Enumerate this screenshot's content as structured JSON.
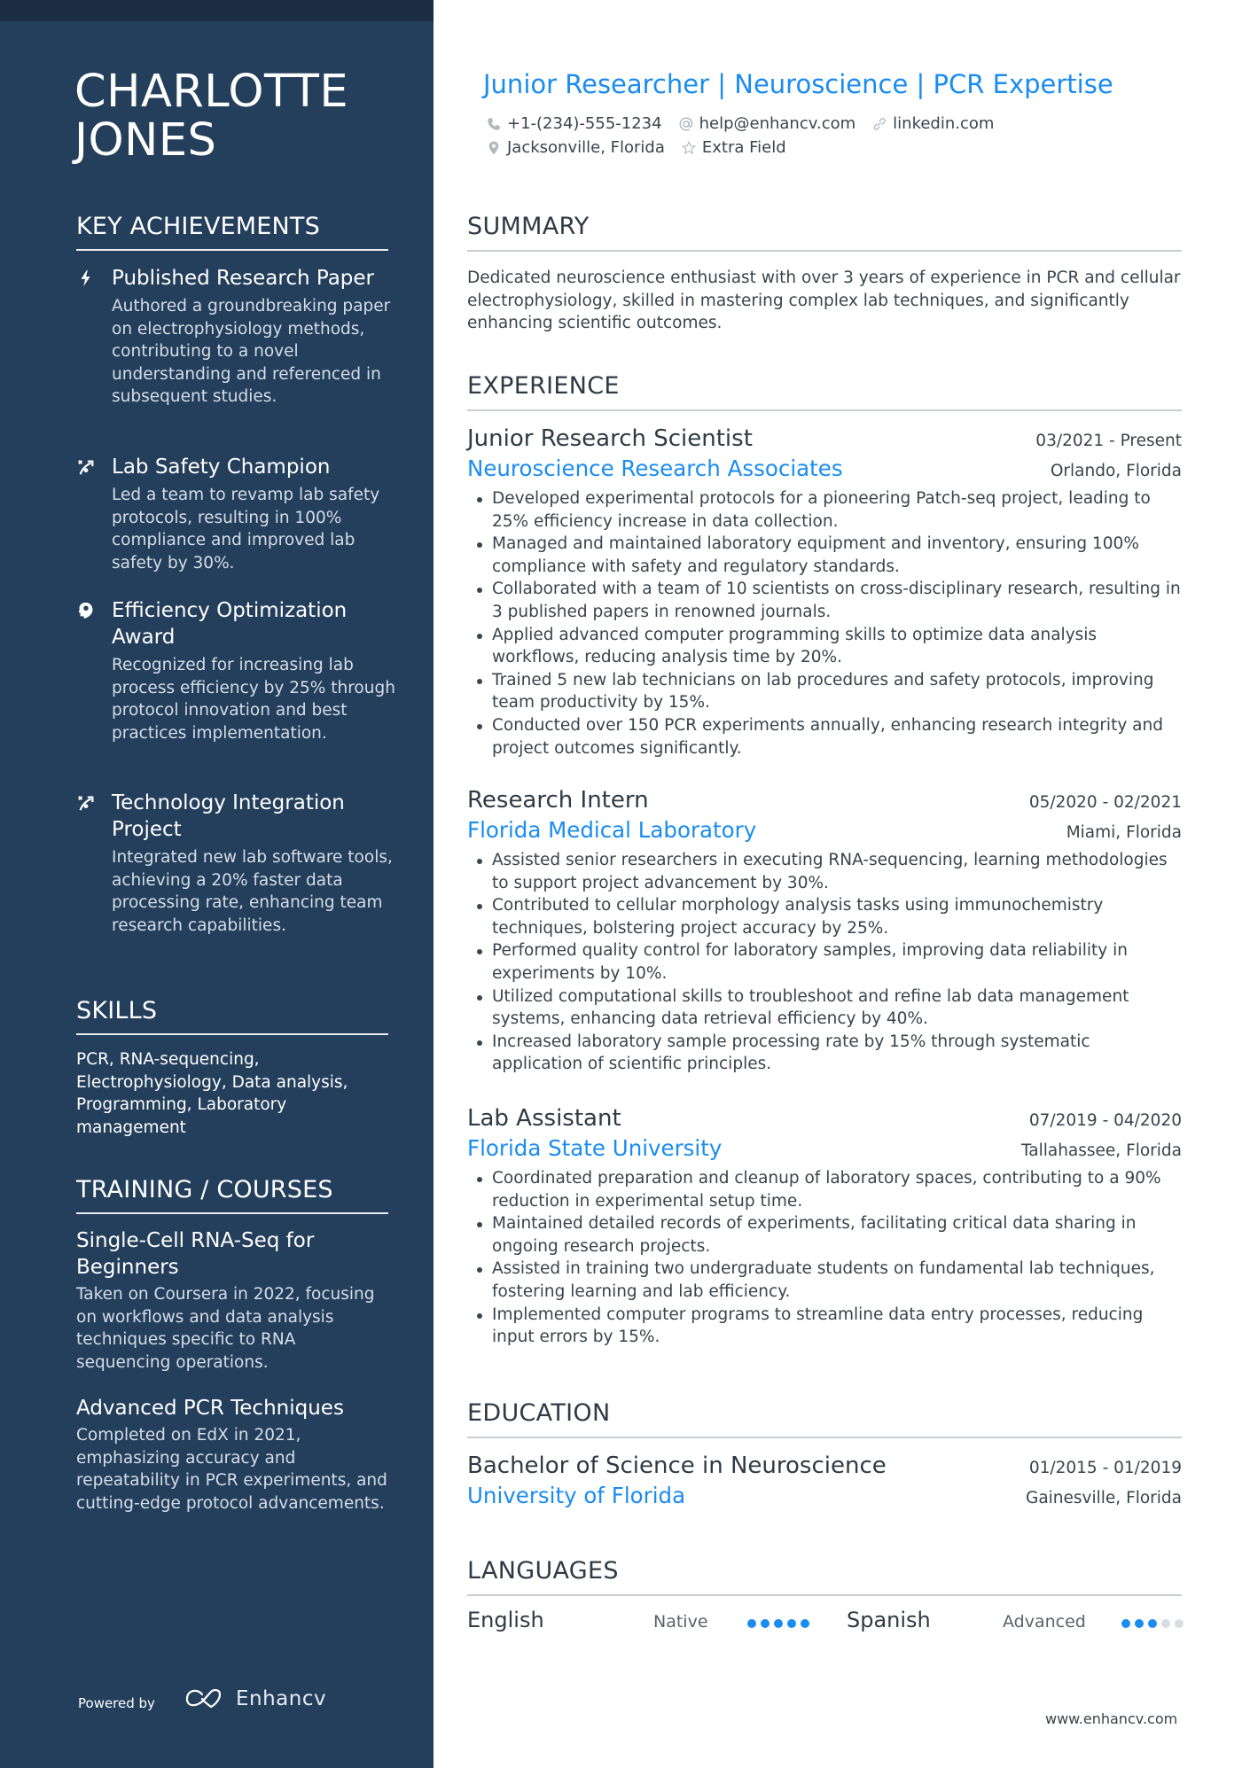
{
  "sidebar": {
    "name_line1": "CHARLOTTE",
    "name_line2": "JONES",
    "achievements_heading": "KEY ACHIEVEMENTS",
    "achievements": [
      {
        "icon": "lightning-icon",
        "title": "Published Research Paper",
        "description": "Authored a groundbreaking paper on electrophysiology methods, contributing to a novel understanding and referenced in subsequent studies."
      },
      {
        "icon": "strategy-icon",
        "title": "Lab Safety Champion",
        "description": "Led a team to revamp lab safety protocols, resulting in 100% compliance and improved lab safety by 30%."
      },
      {
        "icon": "head-brain-icon",
        "title": "Efficiency Optimization Award",
        "description": "Recognized for increasing lab process efficiency by 25% through protocol innovation and best practices implementation."
      },
      {
        "icon": "strategy-icon",
        "title": "Technology Integration Project",
        "description": "Integrated new lab software tools, achieving a 20% faster data processing rate, enhancing team research capabilities."
      }
    ],
    "skills_heading": "SKILLS",
    "skills_text": "PCR, RNA-sequencing, Electrophysiology, Data analysis, Programming, Laboratory management",
    "training_heading": "TRAINING / COURSES",
    "courses": [
      {
        "title": "Single-Cell RNA-Seq for Beginners",
        "description": "Taken on Coursera in 2022, focusing on workflows and data analysis techniques specific to RNA sequencing operations."
      },
      {
        "title": "Advanced PCR Techniques",
        "description": "Completed on EdX in 2021, emphasizing accuracy and repeatability in PCR experiments, and cutting-edge protocol advancements."
      }
    ],
    "powered_by": "Powered by",
    "brand_name": "Enhancv"
  },
  "header": {
    "title": "Junior Researcher | Neuroscience | PCR Expertise",
    "phone": "+1-(234)-555-1234",
    "email": "help@enhancv.com",
    "linkedin": "linkedin.com",
    "location": "Jacksonville, Florida",
    "extra": "Extra Field"
  },
  "summary": {
    "heading": "SUMMARY",
    "text": "Dedicated neuroscience enthusiast with over 3 years of experience in PCR and cellular electrophysiology, skilled in mastering complex lab techniques, and significantly enhancing scientific outcomes."
  },
  "experience": {
    "heading": "EXPERIENCE",
    "jobs": [
      {
        "title": "Junior Research Scientist",
        "dates": "03/2021 - Present",
        "company": "Neuroscience Research Associates",
        "location": "Orlando, Florida",
        "bullets": [
          "Developed experimental protocols for a pioneering Patch-seq project, leading to 25% efficiency increase in data collection.",
          "Managed and maintained laboratory equipment and inventory, ensuring 100% compliance with safety and regulatory standards.",
          "Collaborated with a team of 10 scientists on cross-disciplinary research, resulting in 3 published papers in renowned journals.",
          "Applied advanced computer programming skills to optimize data analysis workflows, reducing analysis time by 20%.",
          "Trained 5 new lab technicians on lab procedures and safety protocols, improving team productivity by 15%.",
          "Conducted over 150 PCR experiments annually, enhancing research integrity and project outcomes significantly."
        ]
      },
      {
        "title": "Research Intern",
        "dates": "05/2020 - 02/2021",
        "company": "Florida Medical Laboratory",
        "location": "Miami, Florida",
        "bullets": [
          "Assisted senior researchers in executing RNA-sequencing, learning methodologies to support project advancement by 30%.",
          "Contributed to cellular morphology analysis tasks using immunochemistry techniques, bolstering project accuracy by 25%.",
          "Performed quality control for laboratory samples, improving data reliability in experiments by 10%.",
          "Utilized computational skills to troubleshoot and refine lab data management systems, enhancing data retrieval efficiency by 40%.",
          "Increased laboratory sample processing rate by 15% through systematic application of scientific principles."
        ]
      },
      {
        "title": "Lab Assistant",
        "dates": "07/2019 - 04/2020",
        "company": "Florida State University",
        "location": "Tallahassee, Florida",
        "bullets": [
          "Coordinated preparation and cleanup of laboratory spaces, contributing to a 90% reduction in experimental setup time.",
          "Maintained detailed records of experiments, facilitating critical data sharing in ongoing research projects.",
          "Assisted in training two undergraduate students on fundamental lab techniques, fostering learning and lab efficiency.",
          "Implemented computer programs to streamline data entry processes, reducing input errors by 15%."
        ]
      }
    ]
  },
  "education": {
    "heading": "EDUCATION",
    "degree": "Bachelor of Science in Neuroscience",
    "dates": "01/2015 - 01/2019",
    "school": "University of Florida",
    "location": "Gainesville, Florida"
  },
  "languages": {
    "heading": "LANGUAGES",
    "items": [
      {
        "name": "English",
        "level": "Native",
        "rating": 5,
        "max": 5
      },
      {
        "name": "Spanish",
        "level": "Advanced",
        "rating": 3,
        "max": 5
      }
    ]
  },
  "footer": {
    "website": "www.enhancv.com"
  },
  "colors": {
    "sidebar_bg": "#243f5c",
    "accent": "#1a8cf0",
    "text": "#3b434b"
  }
}
